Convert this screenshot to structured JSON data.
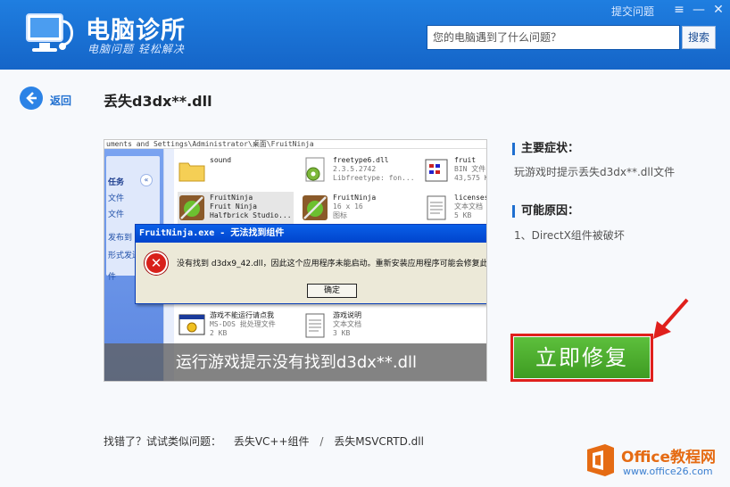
{
  "header": {
    "title": "电脑诊所",
    "subtitle": "电脑问题 轻松解决",
    "feedback_link": "提交问题",
    "menu_icon": "≡",
    "minimize_icon": "—",
    "close_icon": "✕",
    "search": {
      "placeholder": "您的电脑遇到了什么问题？",
      "button_label": "搜索"
    }
  },
  "back_label": "返回",
  "page_title": "丢失d3dx**.dll",
  "screenshot": {
    "path_text": "uments and Settings\\Administrator\\桌面\\FruitNinja",
    "sidebar": {
      "heading": "任务",
      "collapse_icon": "«",
      "items": [
        "文件",
        "文件",
        "发布到",
        "形式发送",
        "件"
      ]
    },
    "files": [
      {
        "name": "sound",
        "sub1": "",
        "sub2": ""
      },
      {
        "name": "freetype6.dll",
        "sub1": "2.3.5.2742",
        "sub2": "Libfreetype: fon..."
      },
      {
        "name": "fruit",
        "sub1": "BIN 文件",
        "sub2": "43,575 K"
      },
      {
        "name": "FruitNinja",
        "sub1": "Fruit Ninja",
        "sub2": "Halfbrick Studio..."
      },
      {
        "name": "FruitNinja",
        "sub1": "16 x 16",
        "sub2": "图标"
      },
      {
        "name": "licenses",
        "sub1": "文本文档",
        "sub2": "5 KB"
      },
      {
        "name": "游戏不能运行请点我",
        "sub1": "MS-DOS 批处理文件",
        "sub2": "2 KB"
      },
      {
        "name": "游戏说明",
        "sub1": "文本文档",
        "sub2": "3 KB"
      }
    ],
    "dialog": {
      "title": "FruitNinja.exe - 无法找到组件",
      "message": "没有找到 d3dx9_42.dll，因此这个应用程序未能启动。重新安装应用程序可能会修复此",
      "ok_label": "确定",
      "error_glyph": "✕"
    },
    "caption": "运行游戏提示没有找到d3dx**.dll"
  },
  "symptom": {
    "label": "主要症状：",
    "text": "玩游戏时提示丢失d3dx**.dll文件"
  },
  "cause": {
    "label": "可能原因：",
    "text": "1、DirectX组件被破坏"
  },
  "fix_button": "立即修复",
  "similar": {
    "prefix": "找错了？试试类似问题：",
    "links": [
      "丢失VC++组件",
      "丢失MSVCRTD.dll"
    ],
    "separator": "/"
  },
  "watermark": {
    "title": "Office教程网",
    "url": "www.office26.com"
  },
  "colors": {
    "header_blue": "#1565c8",
    "accent_green": "#3e9c22",
    "highlight_red": "#e0201c",
    "link_blue": "#1f6fd0"
  }
}
